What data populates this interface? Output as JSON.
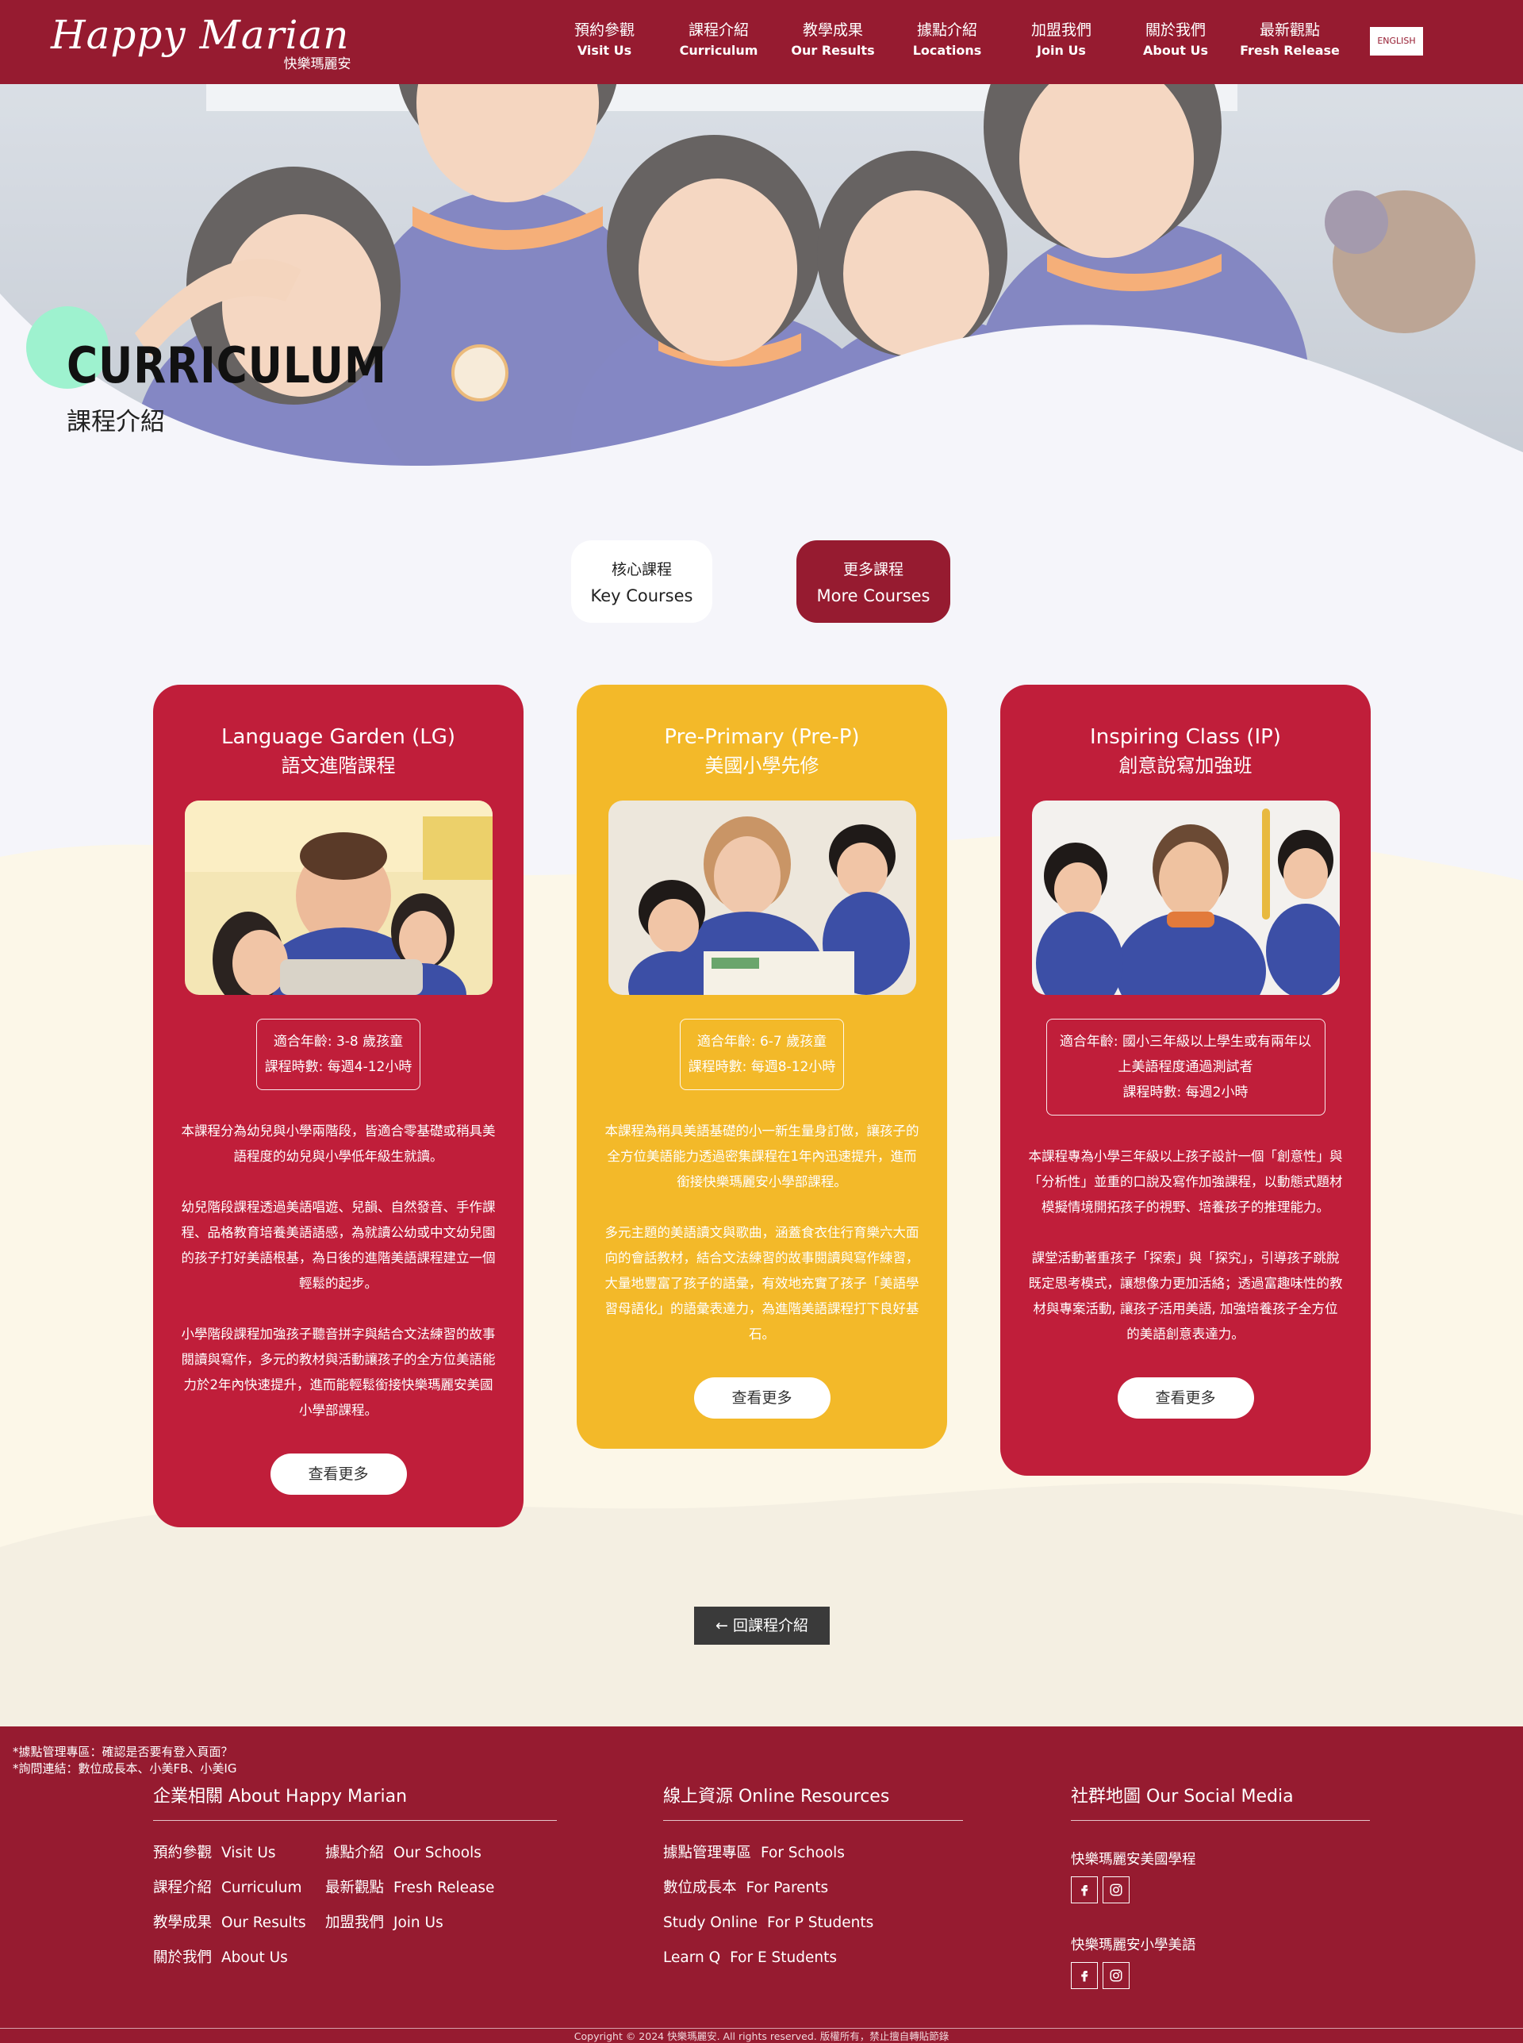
{
  "header": {
    "logo": "Happy Marian",
    "logo_sub": "快樂瑪麗安",
    "nav": [
      {
        "zh": "預約參觀",
        "en": "Visit Us"
      },
      {
        "zh": "課程介紹",
        "en": "Curriculum"
      },
      {
        "zh": "教學成果",
        "en": "Our Results"
      },
      {
        "zh": "據點介紹",
        "en": "Locations"
      },
      {
        "zh": "加盟我們",
        "en": "Join Us"
      },
      {
        "zh": "關於我們",
        "en": "About Us"
      },
      {
        "zh": "最新觀點",
        "en": "Fresh Release"
      }
    ],
    "lang_button": "ENGLISH"
  },
  "hero": {
    "title": "CURRICULUM",
    "subtitle": "課程介紹"
  },
  "tabs": [
    {
      "zh": "核心課程",
      "en": "Key Courses"
    },
    {
      "zh": "更多課程",
      "en": "More Courses"
    }
  ],
  "cards": [
    {
      "title": "Language Garden (LG)",
      "title_zh": "語文進階課程",
      "info": [
        "適合年齡: 3-8 歲孩童",
        "課程時數: 每週4-12小時"
      ],
      "desc": [
        "本課程分為幼兒與小學兩階段，皆適合零基礎或稍具美語程度的幼兒與小學低年級生就讀。",
        "幼兒階段課程透過美語唱遊、兒韻、自然發音、手作課程、品格教育培養美語語感，為就讀公幼或中文幼兒園的孩子打好美語根基，為日後的進階美語課程建立一個輕鬆的起步。",
        "小學階段課程加強孩子聽音拼字與結合文法練習的故事閱讀與寫作，多元的教材與活動讓孩子的全方位美語能力於2年內快速提升，進而能輕鬆銜接快樂瑪麗安美國小學部課程。"
      ],
      "button": "查看更多"
    },
    {
      "title": "Pre-Primary (Pre-P)",
      "title_zh": "美國小學先修",
      "info": [
        "適合年齡: 6-7 歲孩童",
        "課程時數: 每週8-12小時"
      ],
      "desc": [
        "本課程為稍具美語基礎的小一新生量身訂做，讓孩子的全方位美語能力透過密集課程在1年內迅速提升，進而銜接快樂瑪麗安小學部課程。",
        "多元主題的美語讀文與歌曲，涵蓋食衣住行育樂六大面向的會話教材，結合文法練習的故事閱讀與寫作練習，大量地豐富了孩子的語彙，有效地充實了孩子「美語學習母語化」的語彙表達力，為進階美語課程打下良好基石。"
      ],
      "button": "查看更多"
    },
    {
      "title": "Inspiring Class (IP)",
      "title_zh": "創意說寫加強班",
      "info": [
        "適合年齡: 國小三年級以上學生或有兩年以上美語程度通過測試者",
        "課程時數: 每週2小時"
      ],
      "desc": [
        "本課程專為小學三年級以上孩子設計一個「創意性」與「分析性」並重的口說及寫作加強課程，以動態式題材模擬情境開拓孩子的視野、培養孩子的推理能力。",
        "課堂活動著重孩子「探索」與「探究」，引導孩子跳脫既定思考模式，讓想像力更加活絡；透過富趣味性的教材與專案活動, 讓孩子活用美語, 加強培養孩子全方位的美語創意表達力。"
      ],
      "button": "查看更多"
    }
  ],
  "back_button": "← 回課程介紹",
  "footer": {
    "notes": [
      "*據點管理專區：確認是否要有登入頁面？",
      "*詢問連結：數位成長本、小美FB、小美IG"
    ],
    "about": {
      "title": "企業相關 About Happy Marian",
      "links": [
        {
          "zh": "預約參觀",
          "en": "Visit Us"
        },
        {
          "zh": "據點介紹",
          "en": "Our Schools"
        },
        {
          "zh": "課程介紹",
          "en": "Curriculum"
        },
        {
          "zh": "最新觀點",
          "en": "Fresh Release"
        },
        {
          "zh": "教學成果",
          "en": "Our Results"
        },
        {
          "zh": "加盟我們",
          "en": "Join Us"
        },
        {
          "zh": "關於我們",
          "en": "About Us"
        }
      ]
    },
    "resources": {
      "title": "線上資源 Online Resources",
      "links": [
        {
          "zh": "據點管理專區",
          "en": "For Schools"
        },
        {
          "zh": "數位成長本",
          "en": "For Parents"
        },
        {
          "zh": "Study Online",
          "en": "For P Students"
        },
        {
          "zh": "Learn Q",
          "en": "For E Students"
        }
      ]
    },
    "social": {
      "title": "社群地圖 Our Social Media",
      "groups": [
        "快樂瑪麗安美國學程",
        "快樂瑪麗安小學美語"
      ]
    },
    "copyright": "Copyright © 2024 快樂瑪麗安. All rights reserved. 版權所有，禁止擅自轉貼節錄"
  }
}
